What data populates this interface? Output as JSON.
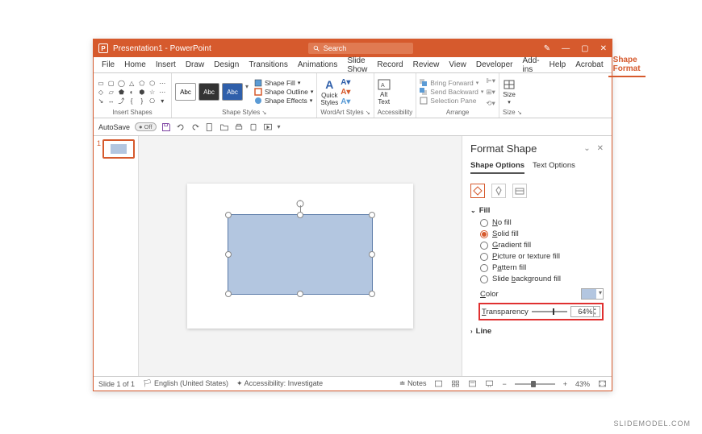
{
  "titlebar": {
    "app_icon": "P",
    "title": "Presentation1 - PowerPoint",
    "search_placeholder": "Search"
  },
  "tabs": [
    "File",
    "Home",
    "Insert",
    "Draw",
    "Design",
    "Transitions",
    "Animations",
    "Slide Show",
    "Record",
    "Review",
    "View",
    "Developer",
    "Add-ins",
    "Help",
    "Acrobat",
    "Shape Format"
  ],
  "active_tab": "Shape Format",
  "ribbon": {
    "groups": {
      "insert_shapes": "Insert Shapes",
      "shape_styles": "Shape Styles",
      "wordart_styles": "WordArt Styles",
      "accessibility": "Accessibility",
      "arrange": "Arrange",
      "size": "Size"
    },
    "style_thumb_text": "Abc",
    "shape_fill": "Shape Fill",
    "shape_outline": "Shape Outline",
    "shape_effects": "Shape Effects",
    "quick_styles": "Quick\nStyles",
    "alt_text": "Alt\nText",
    "bring_forward": "Bring Forward",
    "send_backward": "Send Backward",
    "selection_pane": "Selection Pane",
    "size_btn": "Size"
  },
  "qat": {
    "autosave": "AutoSave",
    "autosave_state": "Off"
  },
  "thumbnail": {
    "num": "1"
  },
  "format_pane": {
    "title": "Format Shape",
    "tab_shape": "Shape Options",
    "tab_text": "Text Options",
    "section_fill": "Fill",
    "section_line": "Line",
    "fill_options": {
      "no_fill": "No fill",
      "solid_fill": "Solid fill",
      "gradient_fill": "Gradient fill",
      "picture_fill": "Picture or texture fill",
      "pattern_fill": "Pattern fill",
      "slide_bg_fill": "Slide background fill"
    },
    "color_label": "Color",
    "transparency_label": "Transparency",
    "transparency_value": "64%"
  },
  "status": {
    "slide_info": "Slide 1 of 1",
    "language": "English (United States)",
    "accessibility": "Accessibility: Investigate",
    "notes": "Notes",
    "zoom": "43%"
  },
  "watermark": "SLIDEMODEL.COM"
}
